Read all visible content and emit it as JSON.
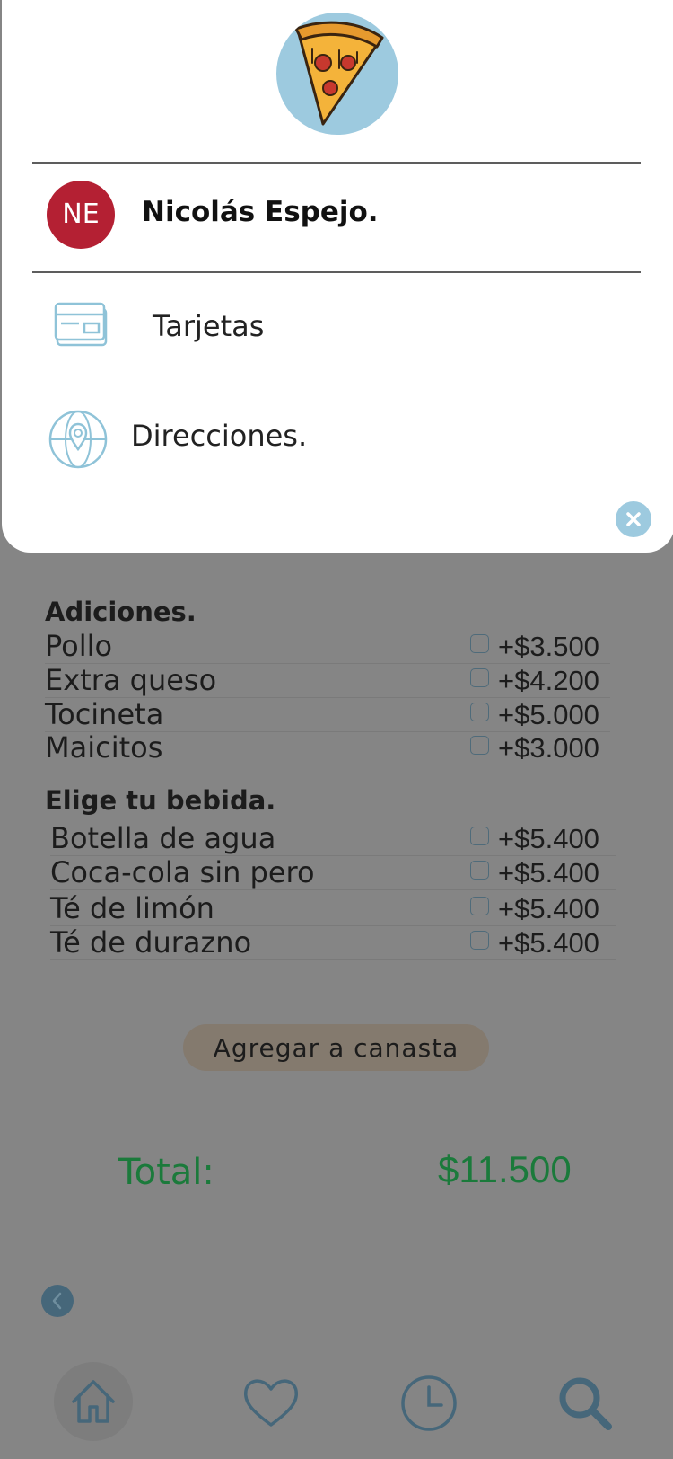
{
  "drawer": {
    "logo_icon": "pizza-slice-icon",
    "user": {
      "initials": "NE",
      "name": "Nicolás Espejo.",
      "avatar_color": "#b42033"
    },
    "menu": [
      {
        "label": "Tarjetas",
        "icon": "credit-card-icon"
      },
      {
        "label": "Direcciones.",
        "icon": "globe-location-icon"
      }
    ],
    "close_icon": "close-icon"
  },
  "additions": {
    "title": "Adiciones.",
    "items": [
      {
        "name": "Pollo",
        "price": "+$3.500"
      },
      {
        "name": "Extra queso",
        "price": "+$4.200"
      },
      {
        "name": "Tocineta",
        "price": "+$5.000"
      },
      {
        "name": "Maicitos",
        "price": "+$3.000"
      }
    ]
  },
  "drinks": {
    "title": "Elige tu bebida.",
    "items": [
      {
        "name": "Botella de agua",
        "price": "+$5.400"
      },
      {
        "name": "Coca-cola sin pero",
        "price": "+$5.400"
      },
      {
        "name": "Té de limón",
        "price": "+$5.400"
      },
      {
        "name": "Té de durazno",
        "price": "+$5.400"
      }
    ]
  },
  "cart": {
    "add_label": "Agregar a canasta"
  },
  "total": {
    "label": "Total:",
    "value": "$11.500",
    "color": "#1b7a3b"
  },
  "nav": {
    "back_icon": "chevron-left-icon",
    "tabs": [
      {
        "icon": "home-icon",
        "active": true
      },
      {
        "icon": "heart-icon",
        "active": false
      },
      {
        "icon": "clock-icon",
        "active": false
      },
      {
        "icon": "search-icon",
        "active": false
      }
    ]
  },
  "colors": {
    "accent": "#9dcadf",
    "overlay": "#858585",
    "nav_icon": "#46677a"
  }
}
